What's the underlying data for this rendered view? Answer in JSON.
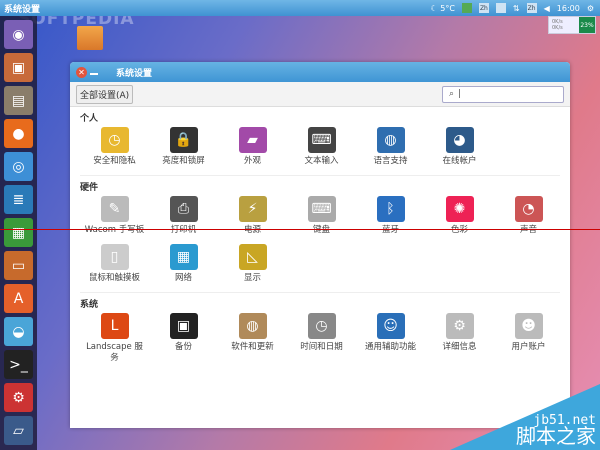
{
  "topbar": {
    "app_title": "系统设置",
    "weather": "☾ 5°C",
    "ime1": "Zh",
    "ime2": "Zh",
    "clock": "16:00"
  },
  "netmon": {
    "up": "0K/s",
    "down": "0K/s",
    "cpu": "23%"
  },
  "watermarks": {
    "softpedia": "SOFTPEDIA",
    "jb51_url": "jb51.net",
    "jb51_name": "脚本之家"
  },
  "launcher": [
    {
      "name": "ubuntu-dash",
      "glyph": "◉",
      "color": "#7a5fb5"
    },
    {
      "name": "software-installer",
      "glyph": "▣",
      "color": "#c86a3a"
    },
    {
      "name": "files",
      "glyph": "▤",
      "color": "#8a7d6a"
    },
    {
      "name": "firefox",
      "glyph": "●",
      "color": "#e86b1c"
    },
    {
      "name": "chromium",
      "glyph": "◎",
      "color": "#3d8fd6"
    },
    {
      "name": "libreoffice-writer",
      "glyph": "≣",
      "color": "#2a7ab8"
    },
    {
      "name": "libreoffice-calc",
      "glyph": "▦",
      "color": "#3a9a3a"
    },
    {
      "name": "libreoffice-impress",
      "glyph": "▭",
      "color": "#c76a2c"
    },
    {
      "name": "software-center",
      "glyph": "A",
      "color": "#e5602a"
    },
    {
      "name": "system-monitor",
      "glyph": "◒",
      "color": "#4aa5d8"
    },
    {
      "name": "terminal",
      "glyph": ">_",
      "color": "#222"
    },
    {
      "name": "system-settings",
      "glyph": "⚙",
      "color": "#c33"
    },
    {
      "name": "workspaces",
      "glyph": "▱",
      "color": "#3a5a8a"
    }
  ],
  "window": {
    "title": "系统设置",
    "all_settings": "全部设置(A)",
    "search_placeholder": "",
    "search_icon": "🔍"
  },
  "sections": [
    {
      "title": "个人",
      "items": [
        {
          "label": "安全和隐私",
          "glyph": "◷",
          "color": "#e8b830"
        },
        {
          "label": "亮度和锁屏",
          "glyph": "🔒",
          "color": "#333"
        },
        {
          "label": "外观",
          "glyph": "▰",
          "color": "#a24aa8"
        },
        {
          "label": "文本输入",
          "glyph": "⌨",
          "color": "#444"
        },
        {
          "label": "语言支持",
          "glyph": "◍",
          "color": "#2f6eb0"
        },
        {
          "label": "在线帐户",
          "glyph": "◕",
          "color": "#2d5a8a"
        }
      ]
    },
    {
      "title": "硬件",
      "items": [
        {
          "label": "Wacom 手写板",
          "glyph": "✎",
          "color": "#bbb"
        },
        {
          "label": "打印机",
          "glyph": "⎙",
          "color": "#555"
        },
        {
          "label": "电源",
          "glyph": "⚡",
          "color": "#b9a040"
        },
        {
          "label": "键盘",
          "glyph": "⌨",
          "color": "#aaa"
        },
        {
          "label": "蓝牙",
          "glyph": "ᛒ",
          "color": "#2a6fc0"
        },
        {
          "label": "色彩",
          "glyph": "✺",
          "color": "#e25"
        },
        {
          "label": "声音",
          "glyph": "◔",
          "color": "#c55"
        },
        {
          "label": "鼠标和触摸板",
          "glyph": "▯",
          "color": "#ccc"
        },
        {
          "label": "网络",
          "glyph": "▦",
          "color": "#2a9ad0"
        },
        {
          "label": "显示",
          "glyph": "◺",
          "color": "#c9a624"
        }
      ]
    },
    {
      "title": "系统",
      "items": [
        {
          "label": "Landscape 服务",
          "glyph": "L",
          "color": "#dd4814"
        },
        {
          "label": "备份",
          "glyph": "▣",
          "color": "#222"
        },
        {
          "label": "软件和更新",
          "glyph": "◍",
          "color": "#b08a5a"
        },
        {
          "label": "时间和日期",
          "glyph": "◷",
          "color": "#888"
        },
        {
          "label": "通用辅助功能",
          "glyph": "☺",
          "color": "#2a6fb8"
        },
        {
          "label": "详细信息",
          "glyph": "⚙",
          "color": "#bbb"
        },
        {
          "label": "用户账户",
          "glyph": "☻",
          "color": "#bbb"
        }
      ]
    }
  ]
}
